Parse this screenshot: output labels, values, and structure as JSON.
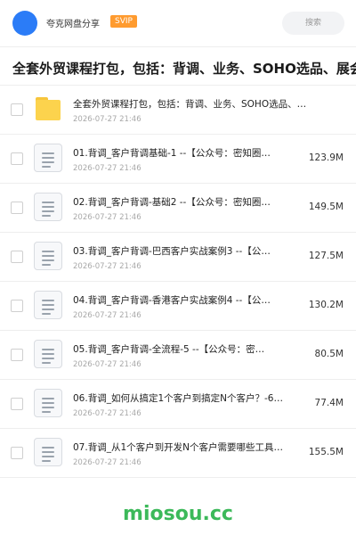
{
  "header": {
    "user_name": "夸克网盘分享",
    "badge": "SVIP",
    "search_placeholder": "搜索"
  },
  "folder_title": "全套外贸课程打包，包括：背调、业务、SOHO选品、展会",
  "items": [
    {
      "type": "folder",
      "name": "全套外贸课程打包，包括：背调、业务、SOHO选品、…",
      "date": "2026-07-27 21:46",
      "size": ""
    },
    {
      "type": "file",
      "name": "01.背调_客户背调基础-1 --【公众号：密知圈…",
      "date": "2026-07-27 21:46",
      "size": "123.9M"
    },
    {
      "type": "file",
      "name": "02.背调_客户背调-基础2 --【公众号：密知圈…",
      "date": "2026-07-27 21:46",
      "size": "149.5M"
    },
    {
      "type": "file",
      "name": "03.背调_客户背调-巴西客户实战案例3 --【公…",
      "date": "2026-07-27 21:46",
      "size": "127.5M"
    },
    {
      "type": "file",
      "name": "04.背调_客户背调-香港客户实战案例4 --【公…",
      "date": "2026-07-27 21:46",
      "size": "130.2M"
    },
    {
      "type": "file",
      "name": "05.背调_客户背调-全流程-5 --【公众号：密…",
      "date": "2026-07-27 21:46",
      "size": "80.5M"
    },
    {
      "type": "file",
      "name": "06.背调_如何从搞定1个客户到搞定N个客户？-6…",
      "date": "2026-07-27 21:46",
      "size": "77.4M"
    },
    {
      "type": "file",
      "name": "07.背调_从1个客户到开发N个客户需要哪些工具？…",
      "date": "2026-07-27 21:46",
      "size": "155.5M"
    }
  ],
  "watermark": "miosou.cc",
  "colors": {
    "accent_blue": "#2b7cf7",
    "svip_orange": "#ff9b2f",
    "folder_yellow": "#fcd34d",
    "watermark_green": "#3cb95a"
  }
}
